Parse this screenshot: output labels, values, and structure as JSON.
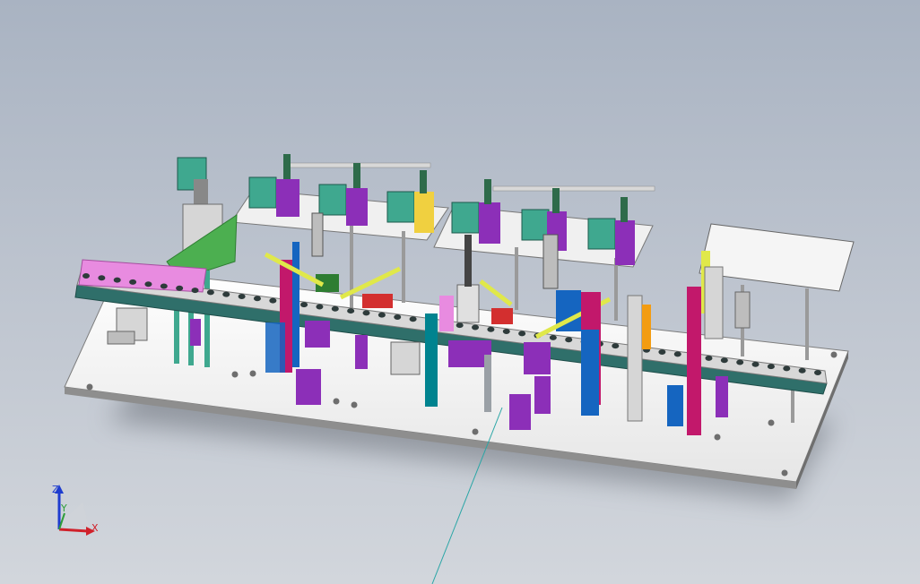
{
  "viewport": {
    "background_top": "#a9b3c2",
    "background_bottom": "#d2d6dc"
  },
  "model": {
    "colors": {
      "baseplate": "#f4f4f4",
      "baseplate_edge": "#8a8a8a",
      "conveyor": "#2f6f6a",
      "motor": "#3fa88f",
      "magenta": "#c2186b",
      "purple": "#8c2fb8",
      "yellow": "#e0e84a",
      "green": "#4caf50",
      "blue": "#1565c0",
      "pink": "#e88be0",
      "orange": "#f39c12",
      "gray": "#9aa0a6",
      "red": "#d32f2f"
    }
  },
  "triad": {
    "z_label": "Z",
    "y_label": "Y",
    "x_label": "X",
    "z_color": "#1e3ccf",
    "y_color": "#2e9d3a",
    "x_color": "#d0202a"
  }
}
